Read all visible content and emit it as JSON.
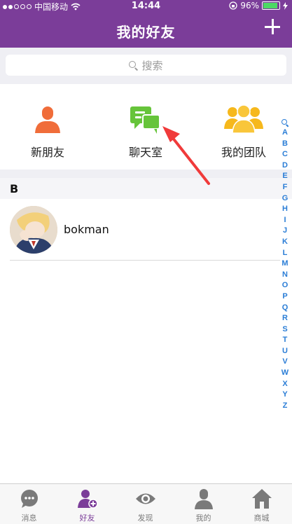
{
  "status_bar": {
    "carrier": "中国移动",
    "time": "14:44",
    "battery": "96%"
  },
  "nav": {
    "title": "我的好友",
    "add_icon": "plus-icon"
  },
  "search": {
    "placeholder": "搜索"
  },
  "actions": [
    {
      "label": "新朋友",
      "icon": "new-friend-icon",
      "color": "#f06d3a"
    },
    {
      "label": "聊天室",
      "icon": "chat-room-icon",
      "color": "#66c43a"
    },
    {
      "label": "我的团队",
      "icon": "team-icon",
      "color": "#f6b81c"
    }
  ],
  "contacts": {
    "section_letter": "B",
    "items": [
      {
        "name": "bokman",
        "avatar": "anime-avatar"
      }
    ]
  },
  "index_letters": [
    "A",
    "B",
    "C",
    "D",
    "E",
    "F",
    "G",
    "H",
    "I",
    "J",
    "K",
    "L",
    "M",
    "N",
    "O",
    "P",
    "Q",
    "R",
    "S",
    "T",
    "U",
    "V",
    "W",
    "X",
    "Y",
    "Z"
  ],
  "tabs": [
    {
      "label": "消息",
      "icon": "message-icon",
      "active": false
    },
    {
      "label": "好友",
      "icon": "friends-icon",
      "active": true
    },
    {
      "label": "发现",
      "icon": "eye-icon",
      "active": false
    },
    {
      "label": "我的",
      "icon": "person-icon",
      "active": false
    },
    {
      "label": "商城",
      "icon": "home-icon",
      "active": false
    }
  ],
  "colors": {
    "brand": "#7b3d99",
    "index": "#2a7dd6",
    "annotation_arrow": "#f03a3a"
  }
}
